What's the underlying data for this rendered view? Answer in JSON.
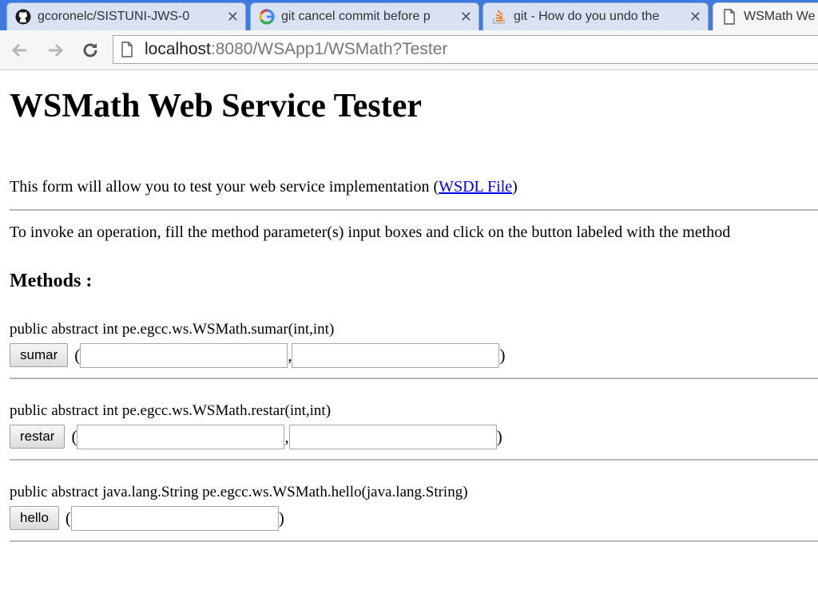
{
  "tabs": [
    {
      "title": "gcoronelc/SISTUNI-JWS-0",
      "icon": "github-icon"
    },
    {
      "title": "git cancel commit before p",
      "icon": "google-icon"
    },
    {
      "title": "git - How do you undo the",
      "icon": "stackoverflow-icon"
    },
    {
      "title": "WSMath We",
      "icon": "page-icon"
    }
  ],
  "address_bar": {
    "host": "localhost",
    "path": ":8080/WSApp1/WSMath?Tester"
  },
  "page": {
    "title": "WSMath Web Service Tester",
    "intro_text": "This form will allow you to test your web service implementation (",
    "wsdl_link": "WSDL File",
    "intro_close": ")",
    "instructions": "To invoke an operation, fill the method parameter(s) input boxes and click on the button labeled with the method",
    "methods_heading": "Methods :",
    "methods": [
      {
        "signature": "public abstract int pe.egcc.ws.WSMath.sumar(int,int)",
        "button": "sumar",
        "param_values": [
          "",
          ""
        ]
      },
      {
        "signature": "public abstract int pe.egcc.ws.WSMath.restar(int,int)",
        "button": "restar",
        "param_values": [
          "",
          ""
        ]
      },
      {
        "signature": "public abstract java.lang.String pe.egcc.ws.WSMath.hello(java.lang.String)",
        "button": "hello",
        "param_values": [
          ""
        ]
      }
    ],
    "punct": {
      "open": "(",
      "comma": ",",
      "close": ")"
    }
  },
  "colors": {
    "tabstrip": "#3f7ae0",
    "link": "#0000ee"
  }
}
